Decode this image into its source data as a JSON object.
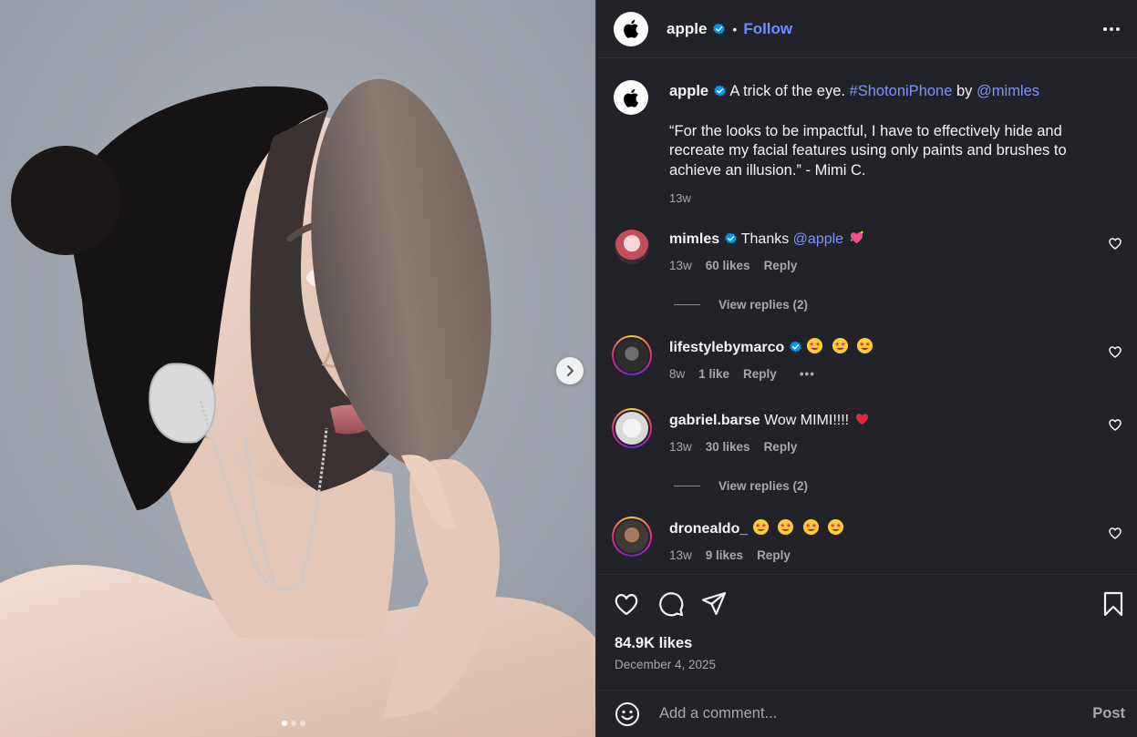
{
  "post": {
    "username": "apple",
    "follow_label": "Follow",
    "separator": "•",
    "likes": "84.9K likes",
    "date": "December 4, 2025"
  },
  "caption": {
    "username": "apple",
    "text_before": "A trick of the eye.",
    "hashtag": "#ShotoniPhone",
    "by": "by",
    "mention": "@mimles",
    "quote": "“For the looks to be impactful, I have to effectively hide and recreate my facial features using only paints and brushes to achieve an illusion.” - Mimi C.",
    "time": "13w"
  },
  "comments": [
    {
      "username": "mimles",
      "verified": true,
      "text": "Thanks",
      "mention": "@apple",
      "emoji": "sparkling-heart",
      "time": "13w",
      "likes": "60 likes",
      "reply": "Reply",
      "view_replies": "View replies (2)"
    },
    {
      "username": "lifestylebymarco",
      "verified": true,
      "emoji": [
        "star-struck",
        "star-struck",
        "star-struck"
      ],
      "time": "8w",
      "likes": "1 like",
      "reply": "Reply",
      "more": "•••"
    },
    {
      "username": "gabriel.barse",
      "verified": false,
      "text": "Wow MIMI!!!!",
      "emoji": "red-heart",
      "time": "13w",
      "likes": "30 likes",
      "reply": "Reply",
      "view_replies": "View replies (2)"
    },
    {
      "username": "dronealdo_",
      "verified": false,
      "emoji": [
        "star-struck",
        "star-struck",
        "star-struck",
        "star-struck"
      ],
      "time": "13w",
      "likes": "9 likes",
      "reply": "Reply"
    }
  ],
  "composer": {
    "placeholder": "Add a comment...",
    "post_label": "Post"
  },
  "carousel": {
    "slide_count": 3,
    "active_index": 0
  },
  "colors": {
    "panel_bg": "#212328",
    "link": "#7c94ff",
    "follow": "#6f8dff",
    "verified": "#0095f6",
    "muted": "#a8a8a8"
  }
}
